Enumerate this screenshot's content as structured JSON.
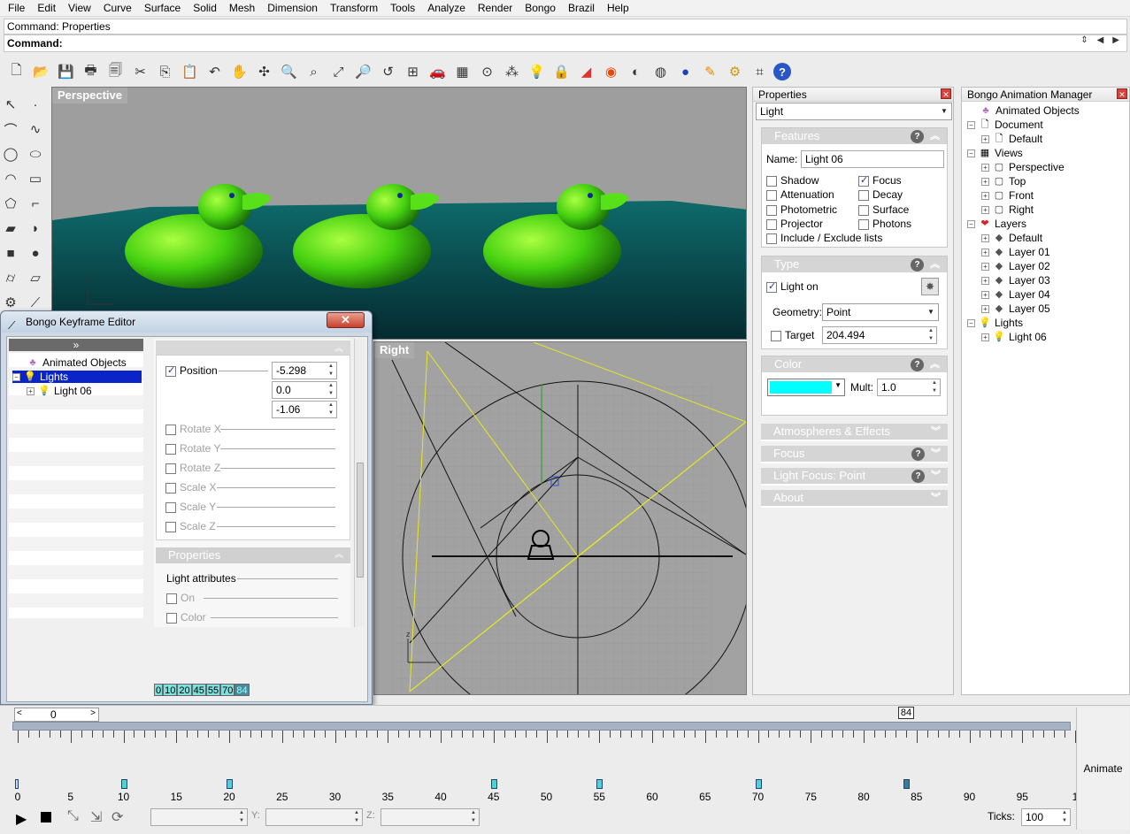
{
  "menu": [
    "File",
    "Edit",
    "View",
    "Curve",
    "Surface",
    "Solid",
    "Mesh",
    "Dimension",
    "Transform",
    "Tools",
    "Analyze",
    "Render",
    "Bongo",
    "Brazil",
    "Help"
  ],
  "command": {
    "history": "Command: Properties",
    "prompt": "Command:"
  },
  "viewports": {
    "perspective_title": "Perspective",
    "right_title": "Right"
  },
  "properties": {
    "title": "Properties",
    "object_type": "Light",
    "features": {
      "header": "Features",
      "name_label": "Name:",
      "name_value": "Light 06",
      "shadow": "Shadow",
      "focus": "Focus",
      "attenuation": "Attenuation",
      "decay": "Decay",
      "photometric": "Photometric",
      "surface": "Surface",
      "projector": "Projector",
      "photons": "Photons",
      "include": "Include / Exclude lists"
    },
    "type": {
      "header": "Type",
      "light_on": "Light on",
      "geometry_label": "Geometry:",
      "geometry_value": "Point",
      "target_label": "Target",
      "target_value": "204.494"
    },
    "color": {
      "header": "Color",
      "swatch": "#00ffff",
      "mult_label": "Mult:",
      "mult_value": "1.0"
    },
    "collapsed": {
      "atmospheres": "Atmospheres & Effects",
      "focus": "Focus",
      "light_focus": "Light Focus: Point",
      "about": "About"
    }
  },
  "bongo": {
    "title": "Bongo Animation Manager",
    "root": "Animated Objects",
    "document": "Document",
    "doc_default": "Default",
    "views": "Views",
    "view_items": [
      "Perspective",
      "Top",
      "Front",
      "Right"
    ],
    "layers": "Layers",
    "layer_items": [
      "Default",
      "Layer 01",
      "Layer 02",
      "Layer 03",
      "Layer 04",
      "Layer 05"
    ],
    "lights": "Lights",
    "light_items": [
      "Light 06"
    ]
  },
  "keyframe_editor": {
    "title": "Bongo Keyframe Editor",
    "chevron": "»",
    "tree_root": "Animated Objects",
    "tree_lights": "Lights",
    "tree_light": "Light 06",
    "position_label": "Position",
    "pos_x": "-5.298",
    "pos_y": "0.0",
    "pos_z": "-1.06",
    "rotate_x": "Rotate X",
    "rotate_y": "Rotate Y",
    "rotate_z": "Rotate Z",
    "scale_x": "Scale X",
    "scale_y": "Scale Y",
    "scale_z": "Scale Z",
    "properties_header": "Properties",
    "light_attributes": "Light attributes",
    "on": "On",
    "color": "Color",
    "frames": [
      "0",
      "10",
      "20",
      "45",
      "55",
      "70",
      "84"
    ]
  },
  "timeline": {
    "current_frame": "0",
    "marker": "84",
    "labels": [
      "0",
      "5",
      "10",
      "15",
      "20",
      "25",
      "30",
      "35",
      "40",
      "45",
      "50",
      "55",
      "60",
      "65",
      "70",
      "75",
      "80",
      "85",
      "90",
      "95",
      "1"
    ],
    "keyframes": [
      0,
      10,
      20,
      45,
      55,
      70,
      84
    ],
    "animate": "Animate",
    "ticks_label": "Ticks:",
    "ticks_value": "100",
    "y_label": "Y:",
    "z_label": "Z:"
  }
}
